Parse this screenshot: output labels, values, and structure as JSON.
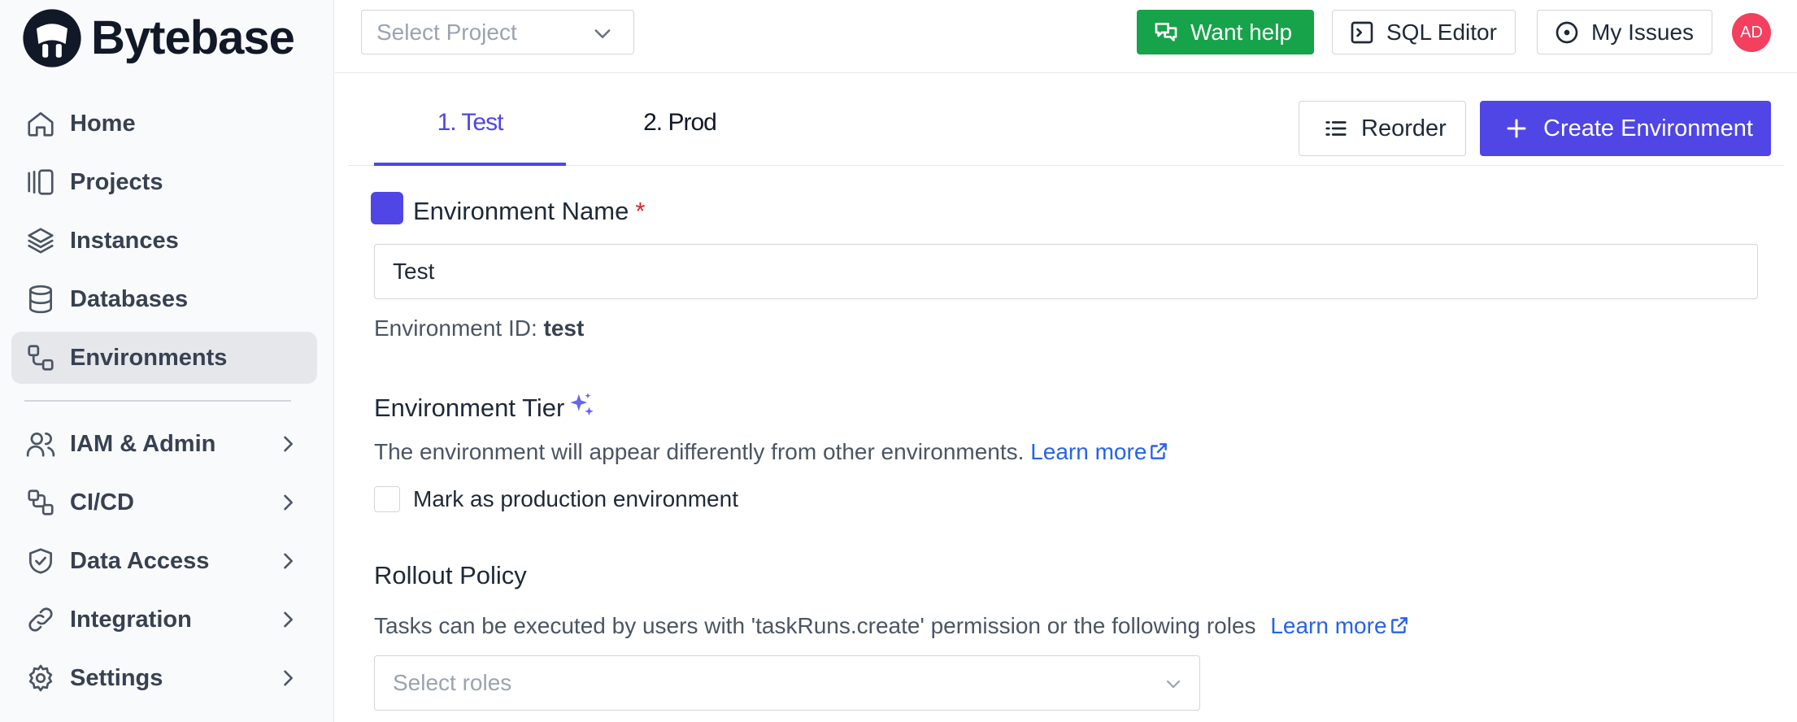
{
  "app": {
    "brand": "Bytebase"
  },
  "sidebar": {
    "items": [
      {
        "label": "Home",
        "icon": "home-icon"
      },
      {
        "label": "Projects",
        "icon": "projects-icon"
      },
      {
        "label": "Instances",
        "icon": "layers-icon"
      },
      {
        "label": "Databases",
        "icon": "database-icon"
      },
      {
        "label": "Environments",
        "icon": "environments-icon",
        "active": true
      },
      {
        "label": "IAM & Admin",
        "icon": "users-icon",
        "expandable": true
      },
      {
        "label": "CI/CD",
        "icon": "workflow-icon",
        "expandable": true
      },
      {
        "label": "Data Access",
        "icon": "shield-check-icon",
        "expandable": true
      },
      {
        "label": "Integration",
        "icon": "link-icon",
        "expandable": true
      },
      {
        "label": "Settings",
        "icon": "gear-icon",
        "expandable": true
      }
    ]
  },
  "topbar": {
    "project_placeholder": "Select Project",
    "want_help": "Want help",
    "sql_editor": "SQL Editor",
    "my_issues": "My Issues",
    "avatar_initials": "AD"
  },
  "tabs": [
    {
      "label": "1. Test",
      "active": true
    },
    {
      "label": "2. Prod",
      "active": false
    }
  ],
  "actions": {
    "reorder": "Reorder",
    "create_environment": "Create Environment"
  },
  "form": {
    "env_name_title": "Environment Name",
    "required_mark": "*",
    "env_name_value": "Test",
    "env_id_label": "Environment ID:",
    "env_id_value": "test",
    "tier_title": "Environment Tier",
    "tier_desc": "The environment will appear differently from other environments.",
    "learn_more": "Learn more",
    "production_checkbox_label": "Mark as production environment",
    "rollout_title": "Rollout Policy",
    "rollout_desc": "Tasks can be executed by users with 'taskRuns.create' permission or the following roles",
    "roles_placeholder": "Select roles"
  },
  "colors": {
    "accent": "#4f46e5",
    "help_green": "#16a34a",
    "avatar": "#f43f5e",
    "link": "#2563eb",
    "required": "#dc2626"
  }
}
